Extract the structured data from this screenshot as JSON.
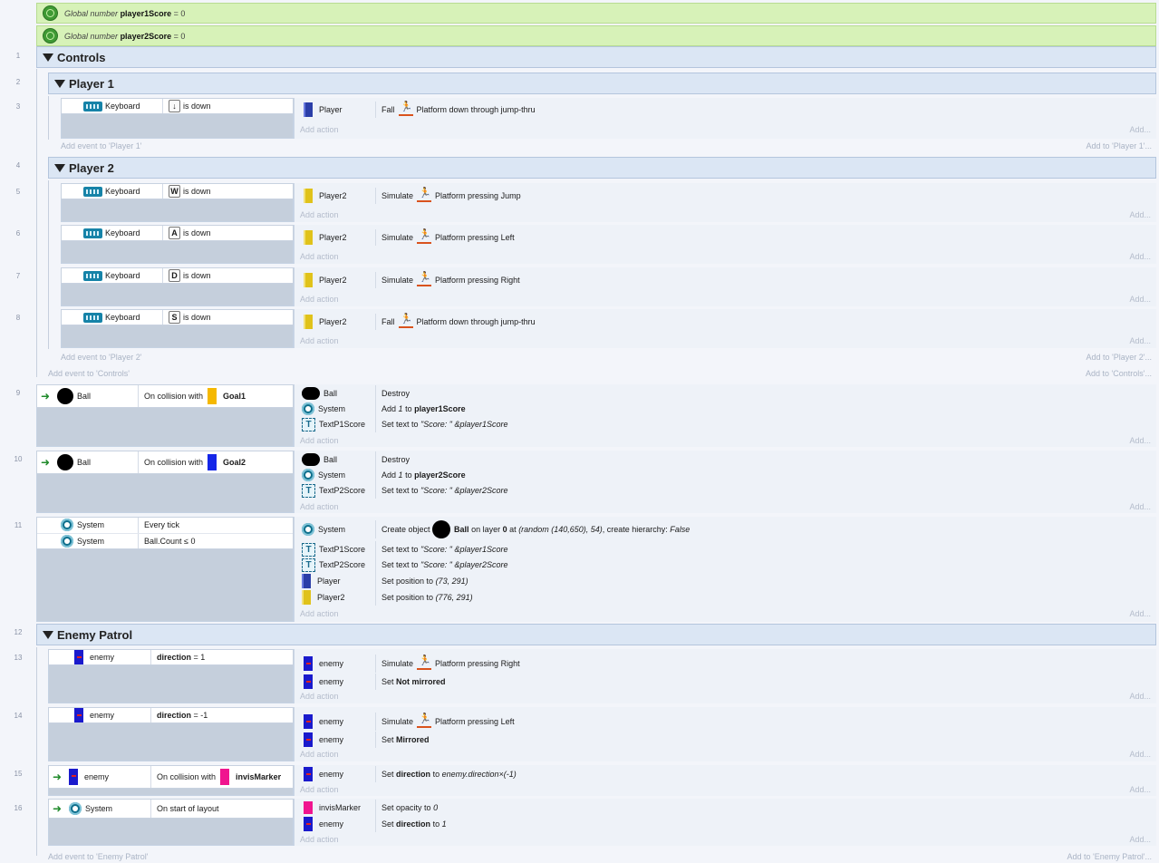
{
  "globals": [
    {
      "prefix": "Global number",
      "name": "player1Score",
      "value": "= 0"
    },
    {
      "prefix": "Global number",
      "name": "player2Score",
      "value": "= 0"
    }
  ],
  "line_numbers": [
    "1",
    "2",
    "3",
    "4",
    "5",
    "6",
    "7",
    "8",
    "9",
    "10",
    "11",
    "12",
    "13",
    "14",
    "15",
    "16"
  ],
  "groups": {
    "controls": "Controls",
    "player1": "Player 1",
    "player2": "Player 2",
    "enemy_patrol": "Enemy Patrol"
  },
  "common": {
    "add_action": "Add action",
    "add_dots": "Add...",
    "keyboard": "Keyboard",
    "is_down": "is down",
    "platform": "Platform",
    "fall": "Fall",
    "simulate": "Simulate"
  },
  "key_labels": {
    "down_arrow": "↓",
    "w": "W",
    "a": "A",
    "d": "D",
    "s": "S"
  },
  "add_event": {
    "player1": "Add event to 'Player 1'",
    "player1_right": "Add to 'Player 1'...",
    "player2": "Add event to 'Player 2'",
    "player2_right": "Add to 'Player 2'...",
    "controls": "Add event to 'Controls'",
    "controls_right": "Add to 'Controls'...",
    "enemy": "Add event to 'Enemy Patrol'",
    "enemy_right": "Add to 'Enemy Patrol'..."
  },
  "objects": {
    "player": "Player",
    "player2": "Player2",
    "ball": "Ball",
    "system": "System",
    "textp1": "TextP1Score",
    "textp2": "TextP2Score",
    "enemy": "enemy",
    "invis": "invisMarker",
    "goal1": "Goal1",
    "goal2": "Goal2"
  },
  "texts": {
    "down_through": "down through jump-thru",
    "pressing_jump": "pressing Jump",
    "pressing_left": "pressing Left",
    "pressing_right": "pressing Right",
    "on_collision": "On collision with",
    "destroy": "Destroy",
    "add": "Add",
    "one": "1",
    "to": "to",
    "player1Score": "player1Score",
    "player2Score": "player2Score",
    "set_text_to": "Set text to",
    "score_expr1": "\"Score: \" &player1Score",
    "score_expr2": "\"Score: \" &player2Score",
    "every_tick": "Every tick",
    "ball_count": "Ball.Count ≤ 0",
    "create_object": "Create object",
    "on_layer": "on layer",
    "zero": "0",
    "at": "at",
    "create_args": "(random (140,650), 54)",
    "create_hier": ", create hierarchy:",
    "false": "False",
    "set_position_to": "Set position to",
    "pos1": "(73, 291)",
    "pos2": "(776, 291)",
    "direction": "direction",
    "eq1": "= 1",
    "eqm1": "= -1",
    "set": "Set",
    "not_mirrored": "Not mirrored",
    "mirrored": "Mirrored",
    "set_direction_to": "Set",
    "dir_expr": "enemy.direction×(-1)",
    "on_start": "On start of layout",
    "set_opacity_to": "Set opacity to",
    "opacity_val": "0",
    "dir_val": "1"
  },
  "colors": {
    "global_bg": "#d7f2b8",
    "group_bg": "#dbe6f4",
    "event_bg": "#c5cfdc",
    "action_bg": "#eef2f8",
    "player": "#2b3ea8",
    "player2": "#e0c21a",
    "goal1": "#f5b800",
    "goal2": "#1426e8",
    "enemy": "#1a1acc",
    "invis": "#f0158f"
  }
}
